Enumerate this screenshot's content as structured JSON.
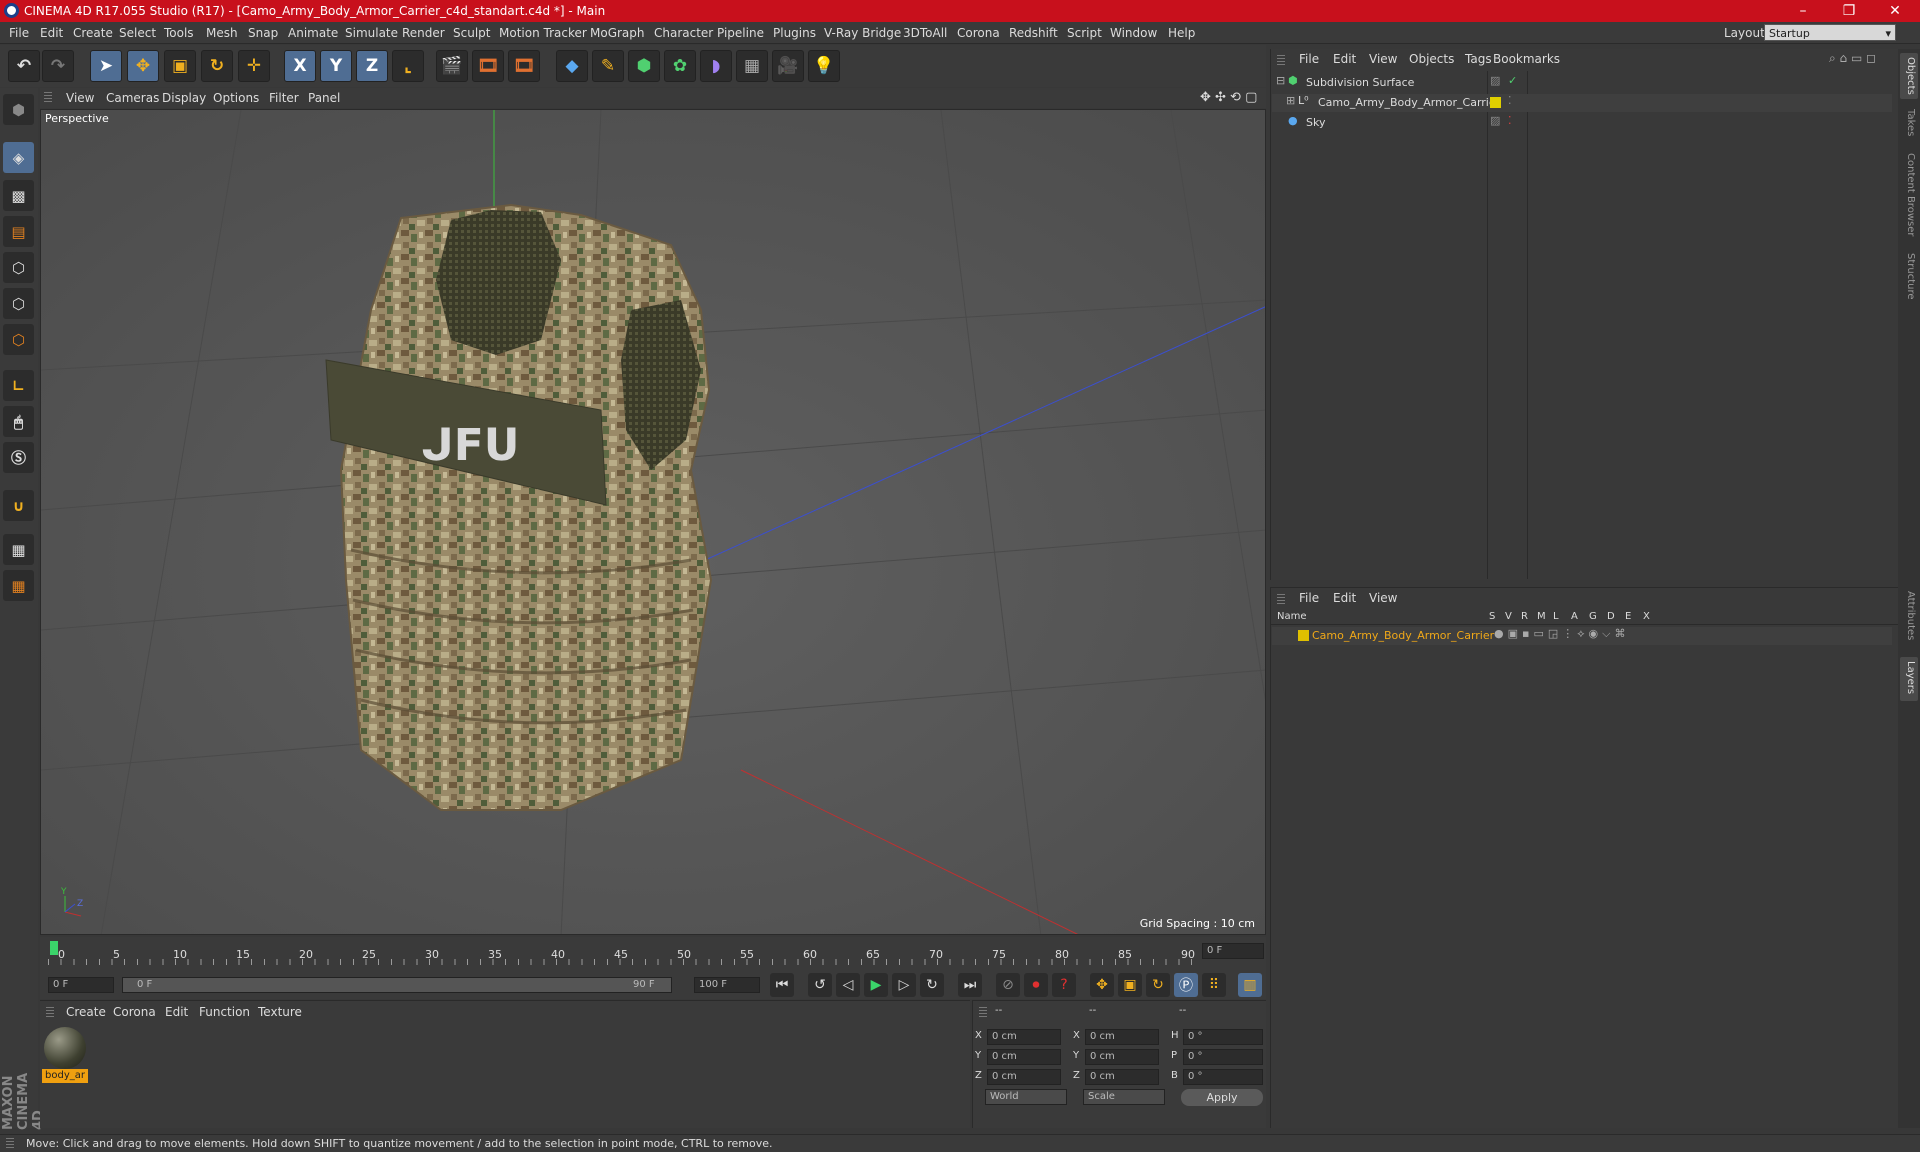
{
  "window": {
    "title": "CINEMA 4D R17.055 Studio (R17) - [Camo_Army_Body_Armor_Carrier_c4d_standart.c4d *] - Main",
    "minimize": "–",
    "restore": "❐",
    "close": "✕"
  },
  "menu": [
    "File",
    "Edit",
    "Create",
    "Select",
    "Tools",
    "Mesh",
    "Snap",
    "Animate",
    "Simulate",
    "Render",
    "Sculpt",
    "Motion Tracker",
    "MoGraph",
    "Character",
    "Pipeline",
    "Plugins",
    "V-Ray Bridge",
    "3DToAll",
    "Corona",
    "Redshift",
    "Script",
    "Window",
    "Help"
  ],
  "layout": {
    "label": "Layout:",
    "value": "Startup"
  },
  "toolbar": {
    "x": "X",
    "y": "Y",
    "z": "Z"
  },
  "viewport": {
    "menu": [
      "View",
      "Cameras",
      "Display",
      "Options",
      "Filter",
      "Panel"
    ],
    "camera_label": "Perspective",
    "grid_spacing": "Grid Spacing : 10 cm",
    "badge_text": "ᒍFᑌ"
  },
  "timeline": {
    "ticks": [
      "0",
      "5",
      "10",
      "15",
      "20",
      "25",
      "30",
      "35",
      "40",
      "45",
      "50",
      "55",
      "60",
      "65",
      "70",
      "75",
      "80",
      "85",
      "90"
    ],
    "current_frame": "0 F"
  },
  "transport": {
    "start": "0 F",
    "range_start": "0 F",
    "range_end": "90 F",
    "end": "100 F"
  },
  "materials": {
    "menu": [
      "Create",
      "Corona",
      "Edit",
      "Function",
      "Texture"
    ],
    "items": [
      {
        "name": "body_ar"
      }
    ]
  },
  "coords": {
    "header": [
      "--",
      "--",
      "--"
    ],
    "rows": [
      {
        "a": "X",
        "av": "0 cm",
        "b": "X",
        "bv": "0 cm",
        "c": "H",
        "cv": "0 °"
      },
      {
        "a": "Y",
        "av": "0 cm",
        "b": "Y",
        "bv": "0 cm",
        "c": "P",
        "cv": "0 °"
      },
      {
        "a": "Z",
        "av": "0 cm",
        "b": "Z",
        "bv": "0 cm",
        "c": "B",
        "cv": "0 °"
      }
    ],
    "world": "World",
    "scale": "Scale",
    "apply": "Apply"
  },
  "objects": {
    "menu": [
      "File",
      "Edit",
      "View",
      "Objects",
      "Tags",
      "Bookmarks"
    ],
    "items": [
      {
        "name": "Subdivision Surface"
      },
      {
        "name": "Camo_Army_Body_Armor_Carrier"
      },
      {
        "name": "Sky"
      }
    ]
  },
  "layers": {
    "menu": [
      "File",
      "Edit",
      "View"
    ],
    "columns": [
      "Name",
      "S",
      "V",
      "R",
      "M",
      "L",
      "A",
      "G",
      "D",
      "E",
      "X"
    ],
    "items": [
      {
        "name": "Camo_Army_Body_Armor_Carrier",
        "color": "#e0c000"
      }
    ]
  },
  "dock_tabs": [
    "Objects",
    "Takes",
    "Content Browser",
    "Structure",
    "Attributes",
    "Layers"
  ],
  "maxon": "MAXON CINEMA 4D",
  "status": "Move: Click and drag to move elements. Hold down SHIFT to quantize movement / add to the selection in point mode, CTRL to remove."
}
